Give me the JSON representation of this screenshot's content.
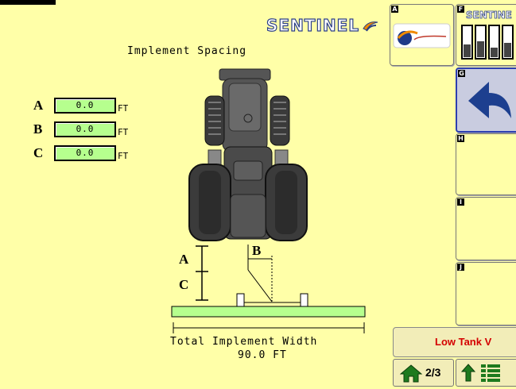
{
  "header": {
    "logo_text": "SENTINEL",
    "page_title": "Implement Spacing"
  },
  "fields": [
    {
      "label": "A",
      "value": "0.0",
      "unit": "FT"
    },
    {
      "label": "B",
      "value": "0.0",
      "unit": "FT"
    },
    {
      "label": "C",
      "value": "0.0",
      "unit": "FT"
    }
  ],
  "diagram": {
    "label_a": "A",
    "label_b": "B",
    "label_c": "C",
    "total_label": "Total Implement Width",
    "total_value": "90.0 FT"
  },
  "side_buttons": [
    {
      "key": "A",
      "icon": "surefire-logo-icon"
    },
    {
      "key": "F",
      "icon": "sentinel-gauges-icon",
      "text": "SENTINE"
    },
    {
      "key": "G",
      "icon": "back-arrow-icon"
    },
    {
      "key": "H",
      "icon": ""
    },
    {
      "key": "I",
      "icon": ""
    },
    {
      "key": "J",
      "icon": ""
    }
  ],
  "alarm": {
    "text": "Low Tank V"
  },
  "nav": {
    "page": "2/3"
  },
  "colors": {
    "background": "#ffffa8",
    "field": "#b6ff8e",
    "alarm_text": "#d40000",
    "accent": "#2d3fb0"
  }
}
